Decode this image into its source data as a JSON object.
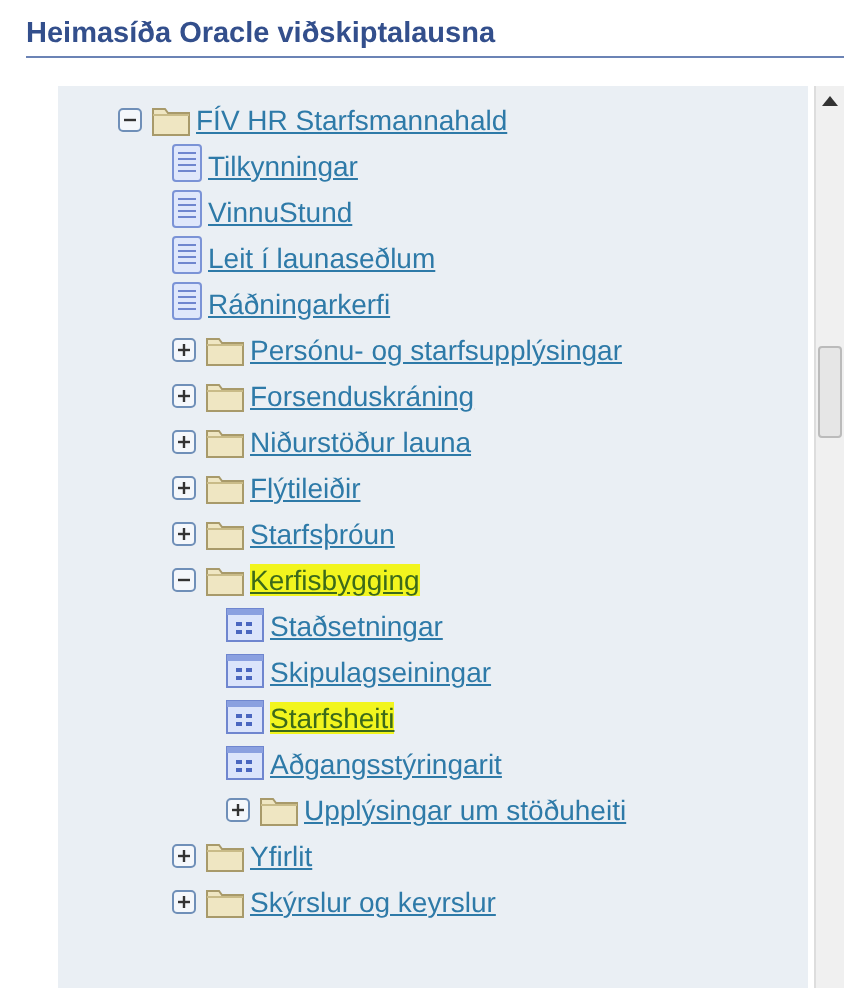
{
  "title": "Heimasíða Oracle viðskiptalausna",
  "tree": [
    {
      "kind": "folder",
      "label": "FÍV HR Starfsmannahald",
      "expanded": true,
      "highlighted": false,
      "children": [
        {
          "kind": "page",
          "label": "Tilkynningar",
          "highlighted": false
        },
        {
          "kind": "page",
          "label": "VinnuStund",
          "highlighted": false
        },
        {
          "kind": "page",
          "label": "Leit í launaseðlum",
          "highlighted": false
        },
        {
          "kind": "page",
          "label": "Ráðningarkerfi",
          "highlighted": false
        },
        {
          "kind": "folder",
          "label": "Persónu- og starfsupplýsingar",
          "expanded": false,
          "highlighted": false
        },
        {
          "kind": "folder",
          "label": "Forsenduskráning",
          "expanded": false,
          "highlighted": false
        },
        {
          "kind": "folder",
          "label": "Niðurstöður launa",
          "expanded": false,
          "highlighted": false
        },
        {
          "kind": "folder",
          "label": "Flýtileiðir",
          "expanded": false,
          "highlighted": false
        },
        {
          "kind": "folder",
          "label": "Starfsþróun",
          "expanded": false,
          "highlighted": false
        },
        {
          "kind": "folder",
          "label": "Kerfisbygging",
          "expanded": true,
          "highlighted": true,
          "children": [
            {
              "kind": "form",
              "label": "Staðsetningar",
              "highlighted": false
            },
            {
              "kind": "form",
              "label": "Skipulagseiningar",
              "highlighted": false
            },
            {
              "kind": "form",
              "label": "Starfsheiti",
              "highlighted": true
            },
            {
              "kind": "form",
              "label": "Aðgangsstýringarit",
              "highlighted": false
            },
            {
              "kind": "folder",
              "label": "Upplýsingar um stöðuheiti",
              "expanded": false,
              "highlighted": false
            }
          ]
        },
        {
          "kind": "folder",
          "label": "Yfirlit",
          "expanded": false,
          "highlighted": false
        },
        {
          "kind": "folder",
          "label": "Skýrslur og keyrslur",
          "expanded": false,
          "highlighted": false
        }
      ]
    }
  ]
}
